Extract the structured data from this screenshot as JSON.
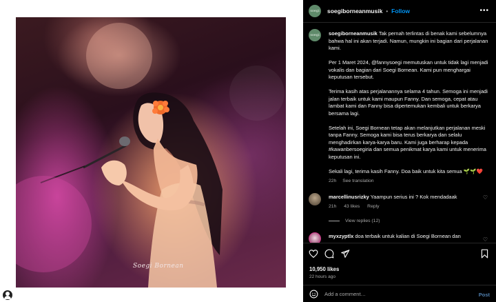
{
  "post": {
    "username": "soegiborneanmusik",
    "follow_label": "Follow",
    "separator": "•",
    "avatar_text": "soegi",
    "image_watermark": "Soegi Bornean",
    "caption": {
      "username": "soegiborneanmusik",
      "paragraphs": [
        "Tak pernah terlintas di benak kami sebelumnya bahwa hal ini akan terjadi. Namun, mungkin ini bagian dari perjalanan kami.",
        "Per 1 Maret 2024, @fannysoegi memutuskan untuk tidak lagi menjadi vokalis dan bagian dari Soegi Bornean. Kami pun menghargai keputusan tersebut.",
        "Terima kasih atas perjalanannya selama 4 tahun. Semoga ini menjadi jalan terbaik untuk kami maupun Fanny. Dan semoga, cepat atau lambat kami dan Fanny bisa dipertemukan kembali untuk berkarya bersama lagi.",
        "Setelah ini, Soegi Bornean tetap akan melanjutkan perjalanan meski tanpa Fanny. Semoga kami bisa terus berkarya dan selalu menghadirkan karya-karya baru. Kami juga berharap kepada #kawanbersoegiria dan semua penikmat karya kami untuk menerima keputusan ini.",
        "Sekali lagi, terima kasih Fanny. Doa baik untuk kita semua 🌱🌱❤️"
      ],
      "time": "22h",
      "see_translation": "See translation"
    },
    "comments": [
      {
        "username": "marcellinusrizky",
        "text": "Yaampun serius ini ? Kok mendadaak",
        "time": "21h",
        "likes": "43 likes",
        "reply": "Reply",
        "view_replies": "View replies (12)"
      },
      {
        "username": "myxzyptlx",
        "text": "doa terbaik untuk kalian di Soegi Bornean dan"
      }
    ],
    "likes_count": "10,950 likes",
    "posted_ago": "22 hours ago",
    "add_comment_placeholder": "Add a comment…",
    "post_label": "Post"
  },
  "icons": [
    "heart-icon",
    "comment-icon",
    "share-icon",
    "bookmark-icon",
    "emoji-icon",
    "more-icon",
    "profile-icon"
  ],
  "colors": {
    "accent": "#0095f6",
    "panel_bg": "#000000",
    "muted_text": "#a8a8a8"
  }
}
